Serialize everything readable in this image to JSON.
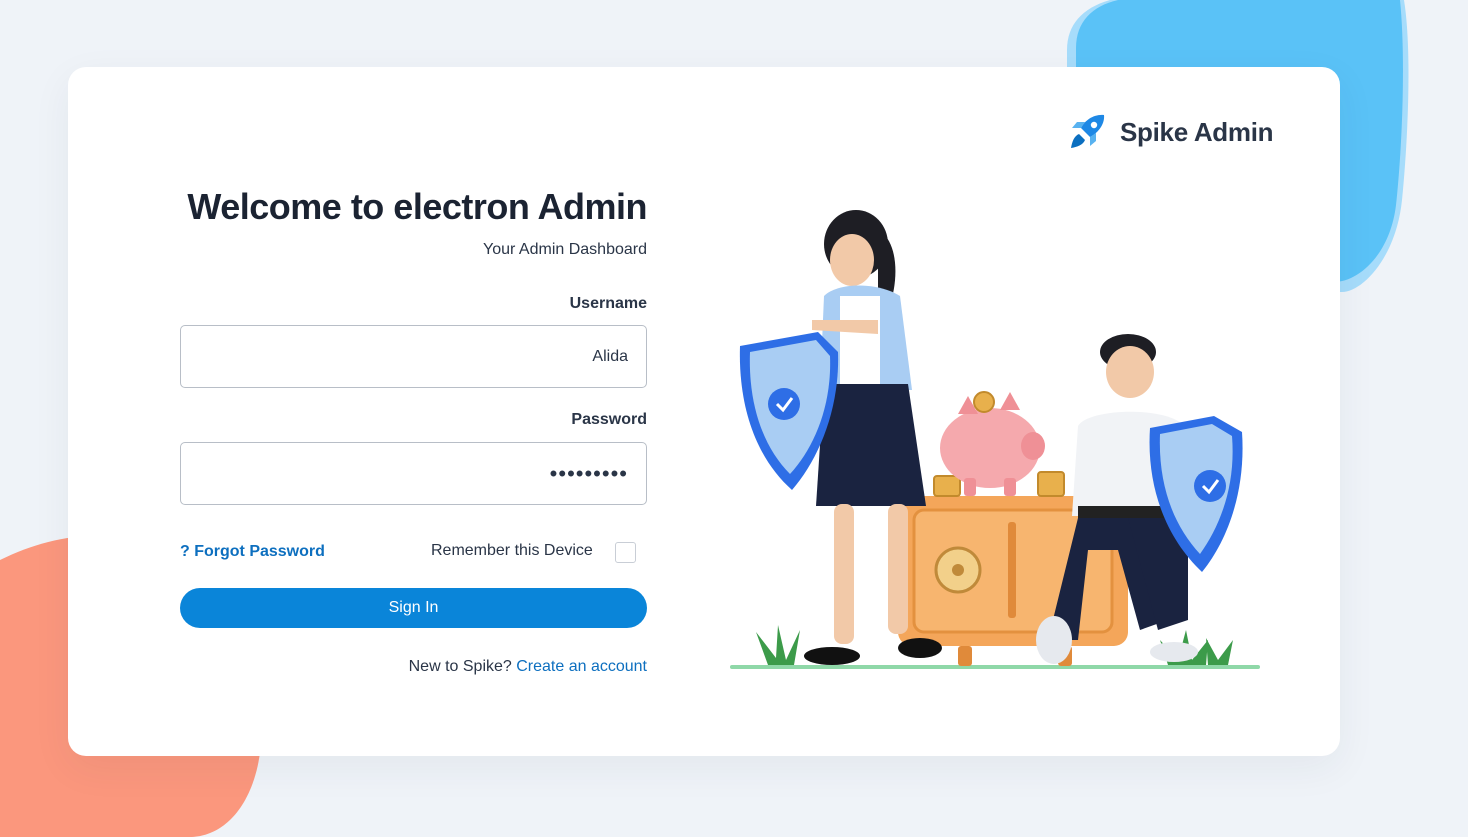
{
  "brand": {
    "name": "Spike Admin",
    "icon": "rocket-icon",
    "icon_color": "#1e88e5"
  },
  "login": {
    "title": "Welcome to electron Admin",
    "subtitle": "Your Admin Dashboard",
    "username_label": "Username",
    "username_value": "Alida",
    "password_label": "Password",
    "password_value": "123456789",
    "forgot_label": "? Forgot Password",
    "remember_label": "Remember this Device",
    "remember_checked": false,
    "signin_label": "Sign In",
    "new_prompt": "New to Spike?",
    "create_link": "Create an account"
  },
  "colors": {
    "primary": "#0a85d9",
    "link": "#0d6fbf",
    "background": "#eff3f8",
    "blob_blue": "#5ac2f7",
    "blob_orange": "#fb977d"
  },
  "illustration": {
    "icons": [
      "shield-check-icon",
      "piggy-bank-icon",
      "safe-icon"
    ]
  }
}
